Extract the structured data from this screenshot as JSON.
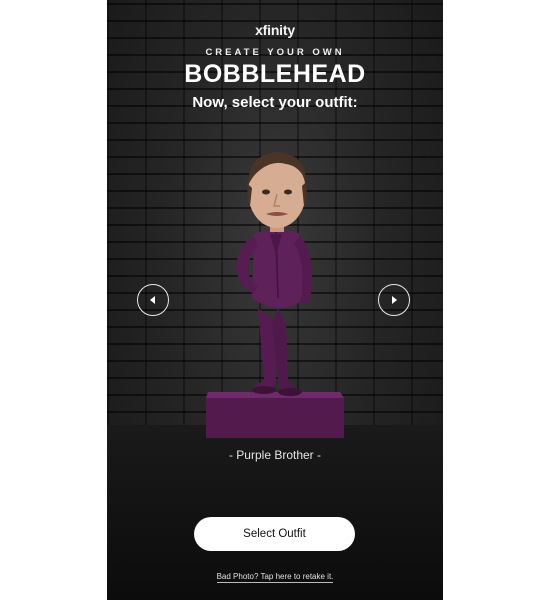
{
  "brand": {
    "logo_text": "xfinity"
  },
  "header": {
    "eyebrow": "CREATE YOUR OWN",
    "title": "BOBBLEHEAD",
    "prompt": "Now, select your outfit:"
  },
  "carousel": {
    "prev_icon": "caret-left-icon",
    "next_icon": "caret-right-icon",
    "outfit_name": "- Purple Brother -"
  },
  "actions": {
    "select_label": "Select Outfit",
    "retake_link": "Bad Photo? Tap here to retake it."
  },
  "colors": {
    "outfit": "#5a1f55",
    "pedestal": "#5c1e57",
    "background": "#1c1c1c",
    "button": "#ffffff"
  }
}
